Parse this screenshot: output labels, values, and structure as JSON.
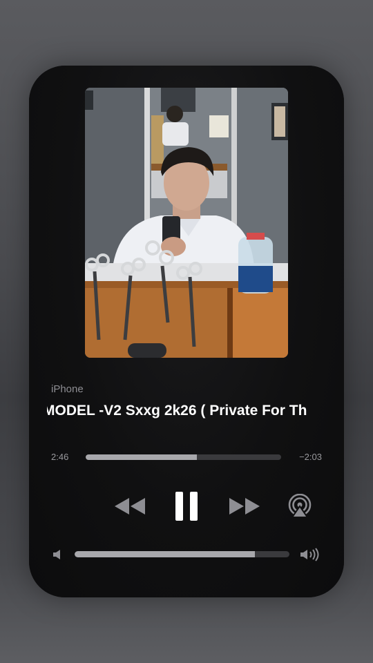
{
  "now_playing": {
    "source": "iPhone",
    "title": "MODEL -V2 Sxxg 2k26 ( Private For Th",
    "elapsed": "2:46",
    "remaining": "−2:03",
    "progress_fraction": 0.57,
    "volume_fraction": 0.84
  },
  "controls": {
    "rewind_icon": "rewind-icon",
    "pause_icon": "pause-icon",
    "forward_icon": "fast-forward-icon",
    "airplay_icon": "airplay-icon",
    "volume_low_icon": "speaker-low-icon",
    "volume_high_icon": "speaker-high-icon"
  },
  "colors": {
    "card_background": "#0f0f10",
    "progress_fill": "#a8a8ac",
    "icon": "#ffffff",
    "icon_dim": "#8e8e93"
  }
}
